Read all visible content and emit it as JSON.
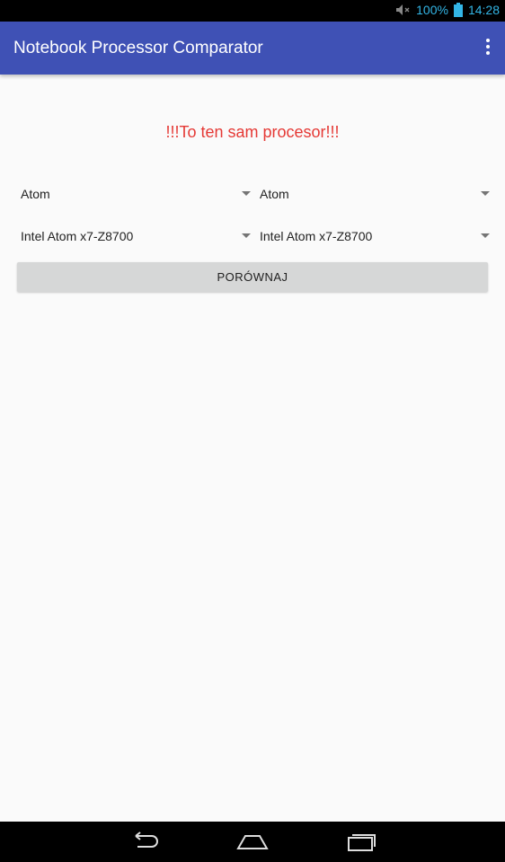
{
  "status_bar": {
    "battery_percent": "100%",
    "time": "14:28",
    "icons": [
      "mute-icon",
      "battery-icon"
    ]
  },
  "app_bar": {
    "title": "Notebook Processor Comparator",
    "overflow_icon": "more-vert-icon"
  },
  "message": "!!!To ten sam procesor!!!",
  "spinners": {
    "family_left": "Atom",
    "family_right": "Atom",
    "model_left": "Intel Atom x7-Z8700",
    "model_right": "Intel Atom x7-Z8700"
  },
  "compare_button_label": "PORÓWNAJ",
  "nav_bar": {
    "icons": [
      "back-icon",
      "home-icon",
      "recents-icon"
    ]
  },
  "colors": {
    "app_bar": "#3f51b5",
    "message": "#e53935",
    "status_text": "#33b5e5",
    "background": "#fafafa"
  }
}
